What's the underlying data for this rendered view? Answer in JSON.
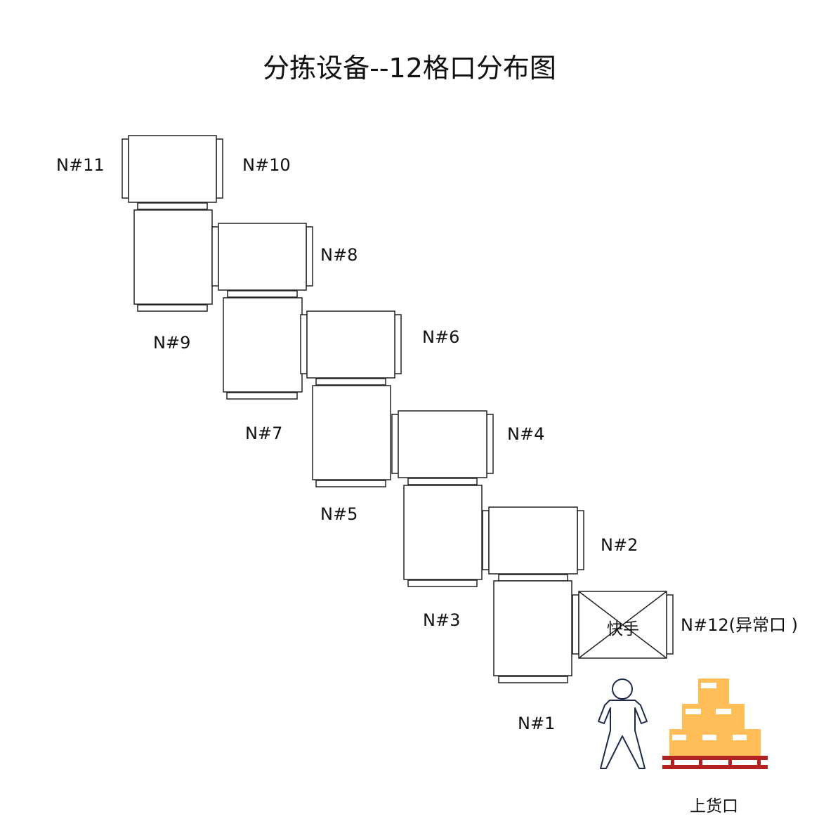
{
  "title": "分拣设备--12格口分布图",
  "ports": {
    "n11": "N#11",
    "n10": "N#10",
    "n9": "N#9",
    "n8": "N#8",
    "n7": "N#7",
    "n6": "N#6",
    "n5": "N#5",
    "n4": "N#4",
    "n3": "N#3",
    "n2": "N#2",
    "n1": "N#1",
    "n12": "N#12(异常口 )"
  },
  "quick_hand": "快手",
  "loading_port": "上货口",
  "colors": {
    "box_fill": "#FFBE57",
    "box_label": "#FFFFFF",
    "pallet": "#B22222",
    "person_stroke": "#1F2A4A",
    "line": "#222222"
  }
}
